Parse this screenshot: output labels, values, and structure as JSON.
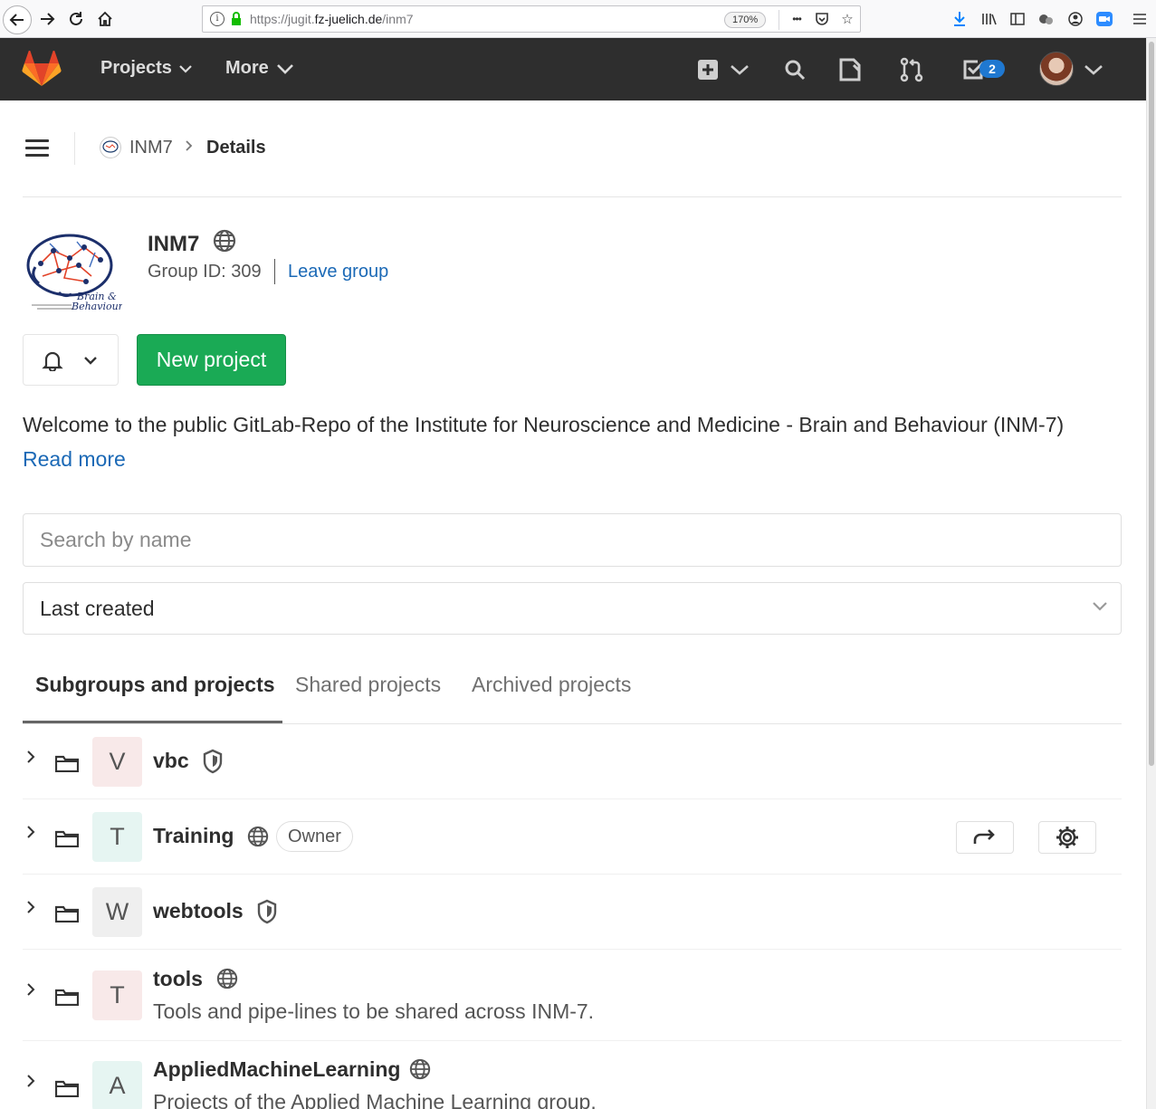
{
  "browser": {
    "url_prefix": "https://jugit.",
    "url_domain": "fz-juelich.de",
    "url_path": "/inm7",
    "zoom": "170%",
    "more_glyph": "•••"
  },
  "header": {
    "nav_projects": "Projects",
    "nav_more": "More",
    "todo_count": "2"
  },
  "breadcrumb": {
    "group": "INM7",
    "current": "Details"
  },
  "group": {
    "name": "INM7",
    "id_text": "Group ID: 309",
    "leave_label": "Leave group",
    "logo_text_1": "Brain &",
    "logo_text_2": "Behaviour",
    "new_project_label": "New project",
    "description": "Welcome to the public GitLab-Repo of the Institute for Neuroscience and Medicine - Brain and Behaviour (INM-7)",
    "read_more": "Read more"
  },
  "filters": {
    "search_placeholder": "Search by name",
    "sort_value": "Last created"
  },
  "tabs": [
    "Subgroups and projects",
    "Shared projects",
    "Archived projects"
  ],
  "rows": [
    {
      "letter": "V",
      "name": "vbc",
      "visibility": "internal",
      "avatar_color": "#f8e9e9"
    },
    {
      "letter": "T",
      "name": "Training",
      "visibility": "public",
      "role": "Owner",
      "avatar_color": "#e6f5f2"
    },
    {
      "letter": "W",
      "name": "webtools",
      "visibility": "internal",
      "avatar_color": "#efefef"
    },
    {
      "letter": "T",
      "name": "tools",
      "visibility": "public",
      "description": "Tools and pipe-lines to be shared across INM-7.",
      "avatar_color": "#f8e9e9"
    },
    {
      "letter": "A",
      "name": "AppliedMachineLearning",
      "visibility": "public",
      "description": "Projects of the Applied Machine Learning group.",
      "avatar_color": "#e6f5f2"
    }
  ],
  "colors": {
    "header_bg": "#2e2e2e",
    "primary_green": "#1aaa55",
    "link_blue": "#1b69b6",
    "badge_blue": "#1f78d1"
  }
}
